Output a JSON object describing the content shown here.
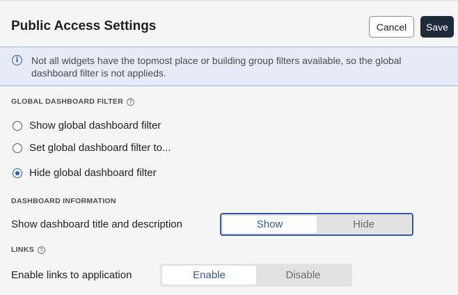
{
  "header": {
    "title": "Public Access Settings",
    "cancel_label": "Cancel",
    "save_label": "Save"
  },
  "banner": {
    "icon": "info-icon",
    "text": "Not all widgets have the topmost place or building group filters available, so the global dashboard filter is not applieds."
  },
  "global_filter": {
    "label": "GLOBAL DASHBOARD FILTER",
    "options": [
      {
        "label": "Show global dashboard filter",
        "checked": false
      },
      {
        "label": "Set global dashboard filter to...",
        "checked": false
      },
      {
        "label": "Hide global dashboard filter",
        "checked": true
      }
    ]
  },
  "dashboard_info": {
    "label": "DASHBOARD INFORMATION",
    "row_label": "Show dashboard title and description",
    "toggle": {
      "on_label": "Show",
      "off_label": "Hide",
      "selected": "Show"
    }
  },
  "links": {
    "label": "LINKS",
    "row_label": "Enable links to application",
    "toggle": {
      "on_label": "Enable",
      "off_label": "Disable",
      "selected": "Enable"
    }
  },
  "colors": {
    "accent": "#2f5aa8",
    "save_bg": "#1d2a38",
    "banner_bg": "#e6ecf5"
  }
}
